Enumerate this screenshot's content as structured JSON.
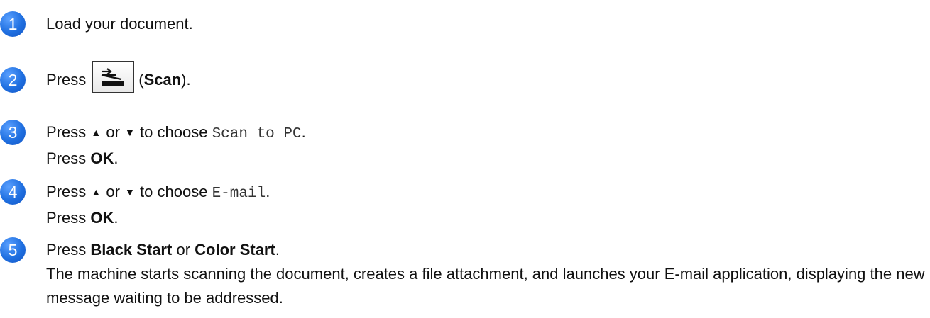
{
  "steps": [
    {
      "number": "1",
      "text": "Load your document."
    },
    {
      "number": "2",
      "prefix": "Press",
      "key_icon": "scan-key-icon",
      "suffix_open": "(",
      "key_label": "Scan",
      "suffix_close": ")."
    },
    {
      "number": "3",
      "line1_a": "Press",
      "up_symbol": "▲",
      "line1_or": "or",
      "down_symbol": "▼",
      "line1_b": "to choose",
      "option": "Scan to PC",
      "line1_end": ".",
      "line2_prefix": "Press",
      "line2_key": "OK",
      "line2_end": "."
    },
    {
      "number": "4",
      "line1_a": "Press",
      "up_symbol": "▲",
      "line1_or": "or",
      "down_symbol": "▼",
      "line1_b": "to choose",
      "option": "E-mail",
      "line1_end": ".",
      "line2_prefix": "Press",
      "line2_key": "OK",
      "line2_end": "."
    },
    {
      "number": "5",
      "line1_prefix": "Press",
      "key1": "Black Start",
      "or": "or",
      "key2": "Color Start",
      "line1_end": ".",
      "paragraph": "The machine starts scanning the document, creates a file attachment, and launches your E-mail application, displaying the new message waiting to be addressed."
    }
  ],
  "colors": {
    "badge": "#1f6fe0",
    "text": "#111111"
  }
}
